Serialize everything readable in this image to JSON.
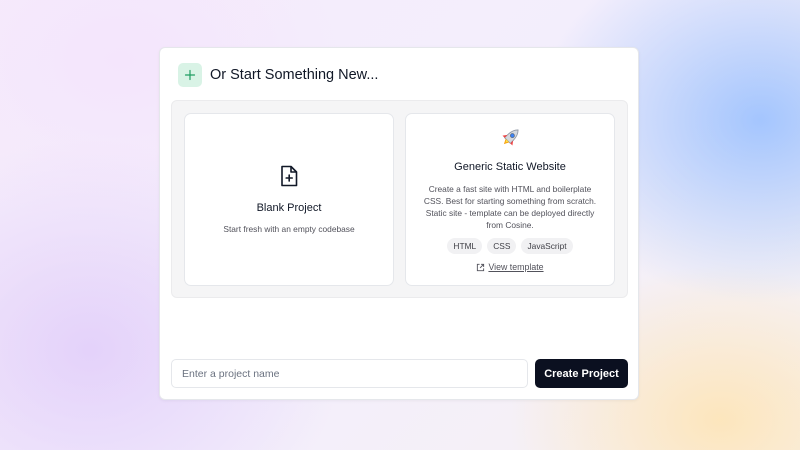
{
  "section": {
    "title": "Or Start Something New...",
    "accent_color": "#d9f3e6"
  },
  "options": [
    {
      "title": "Blank Project",
      "description": "Start fresh with an empty codebase",
      "icon": "file-plus-icon"
    },
    {
      "title": "Generic Static Website",
      "description": "Create a fast site with HTML and boilerplate CSS. Best for starting something from scratch. Static site - template can be deployed directly from Cosine.",
      "icon": "rocket-icon",
      "tags": [
        "HTML",
        "CSS",
        "JavaScript"
      ],
      "link_label": "View template"
    }
  ],
  "form": {
    "name_placeholder": "Enter a project name",
    "name_value": "",
    "create_label": "Create Project",
    "button_color": "#0b1020"
  }
}
